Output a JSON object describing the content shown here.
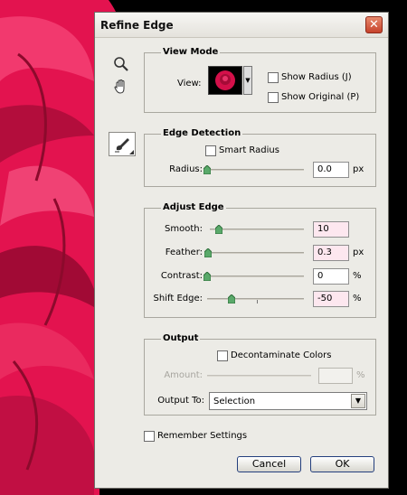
{
  "dialog": {
    "title": "Refine Edge",
    "close": "✕"
  },
  "view_mode": {
    "title": "View Mode",
    "view_label": "View:",
    "show_radius": "Show Radius (J)",
    "show_original": "Show Original (P)"
  },
  "edge_detection": {
    "title": "Edge Detection",
    "smart_radius": "Smart Radius",
    "radius_label": "Radius:",
    "radius_value": "0.0",
    "radius_unit": "px",
    "radius_level": 0
  },
  "adjust_edge": {
    "title": "Adjust Edge",
    "smooth_label": "Smooth:",
    "smooth_value": "10",
    "smooth_level": 0.1,
    "feather_label": "Feather:",
    "feather_value": "0.3",
    "feather_unit": "px",
    "feather_level": 0.01,
    "contrast_label": "Contrast:",
    "contrast_value": "0",
    "contrast_unit": "%",
    "contrast_level": 0,
    "shift_label": "Shift Edge:",
    "shift_value": "-50",
    "shift_unit": "%",
    "shift_level": 0.25
  },
  "output": {
    "title": "Output",
    "decontaminate": "Decontaminate Colors",
    "amount_label": "Amount:",
    "amount_unit": "%",
    "output_to_label": "Output To:",
    "output_to_value": "Selection"
  },
  "remember_settings": "Remember Settings",
  "buttons": {
    "cancel": "Cancel",
    "ok": "OK"
  },
  "colors": {
    "rose": "#e3134f",
    "rose_dark": "#8c0a2c",
    "slider_thumb": "#5aa96a"
  }
}
